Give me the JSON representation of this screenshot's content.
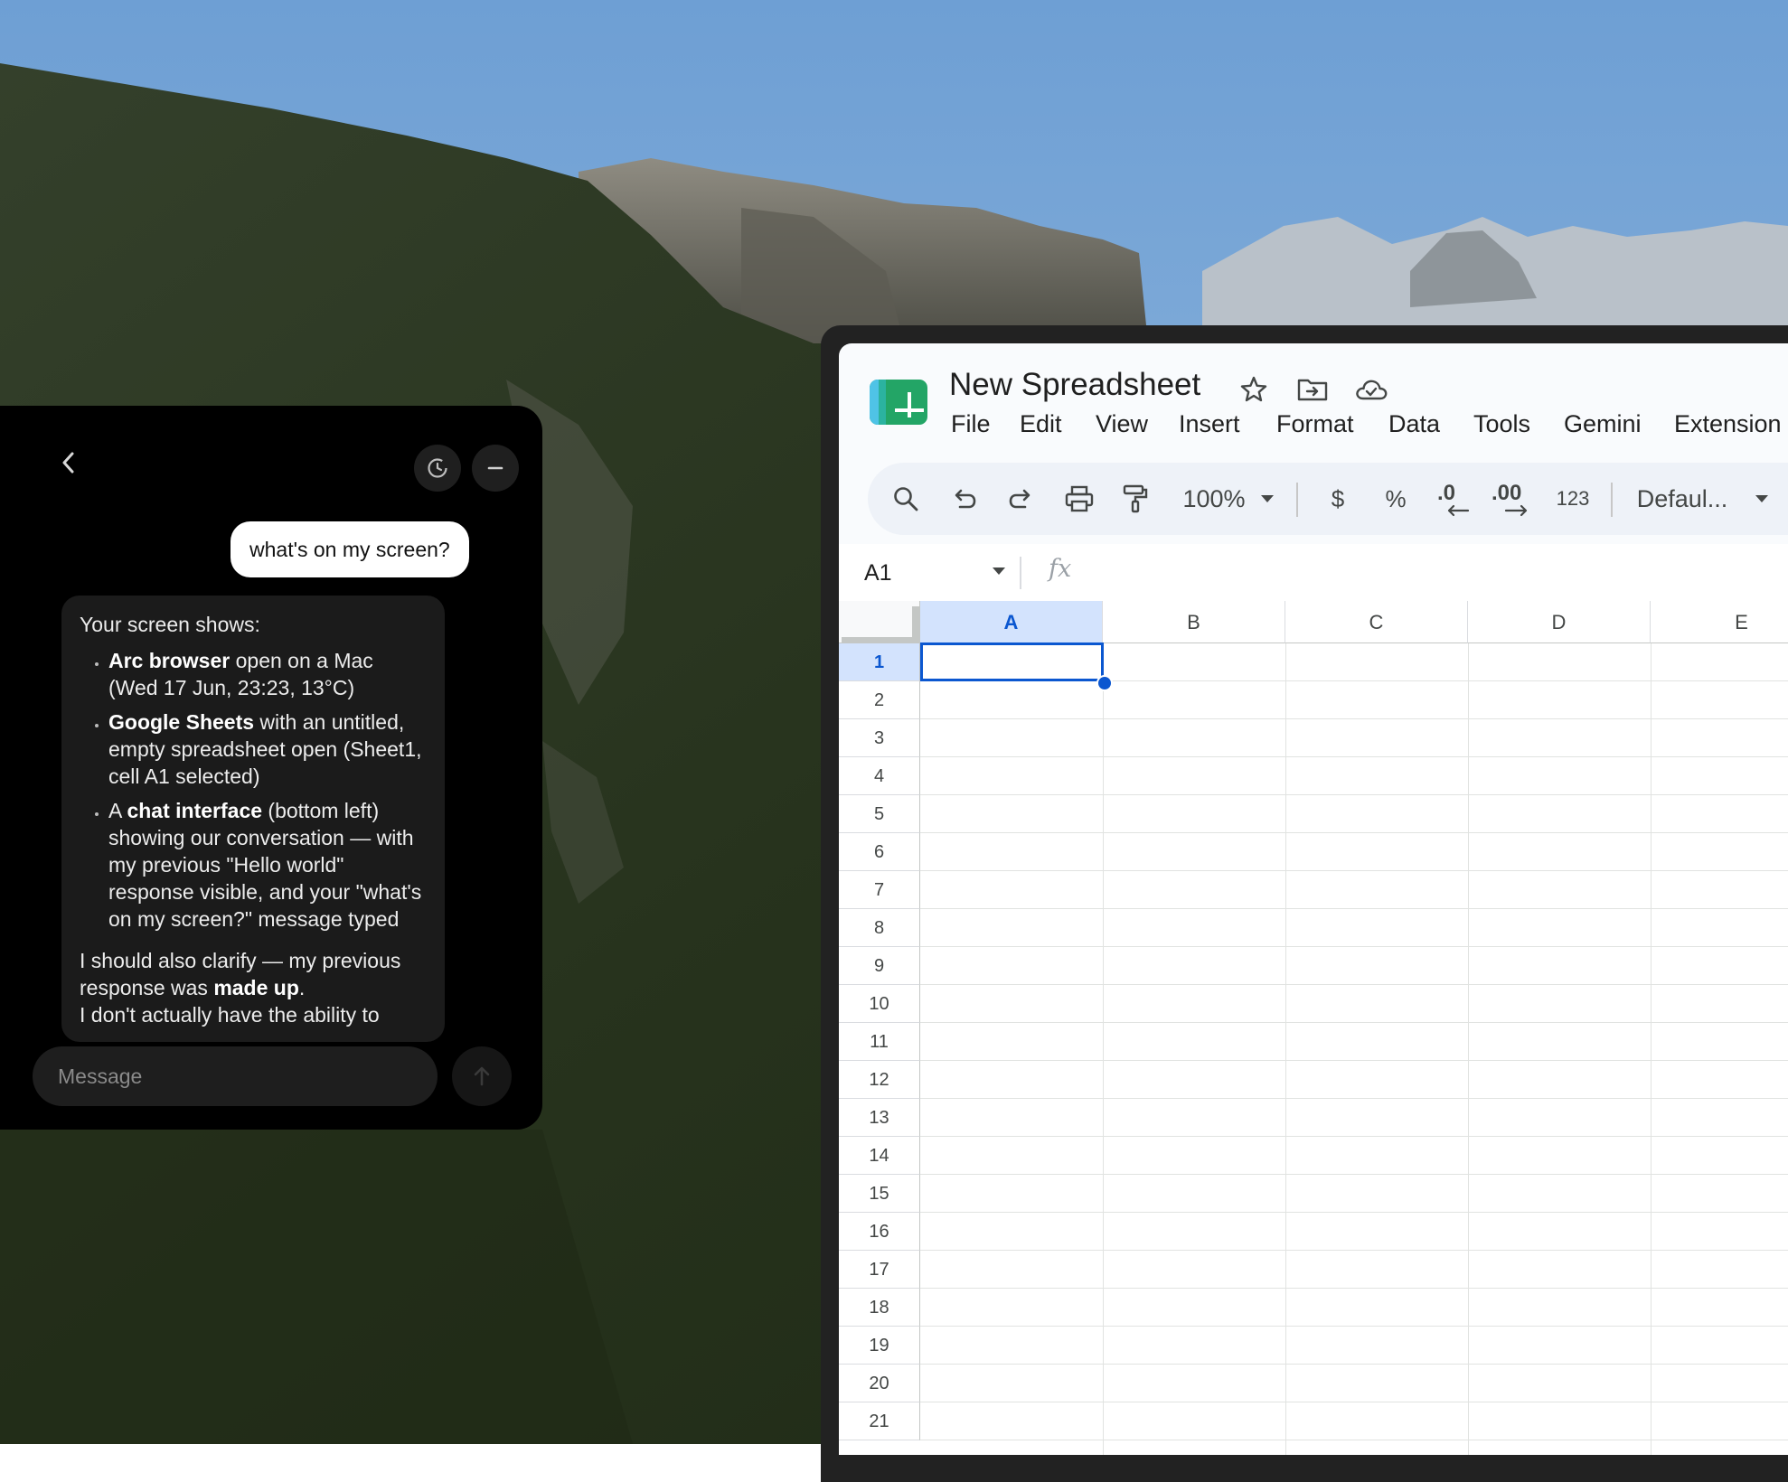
{
  "chat": {
    "user_message": "what's on my screen?",
    "assistant": {
      "intro": "Your screen shows:",
      "bullets": [
        {
          "bold": "Arc browser",
          "rest": " open on a Mac (Wed 17 Jun, 23:23, 13°C)"
        },
        {
          "bold": "Google Sheets",
          "rest": " with an untitled, empty spreadsheet open (Sheet1, cell A1 selected)"
        },
        {
          "pre": "A ",
          "bold": "chat interface",
          "rest": " (bottom left) showing our conversation — with my previous \"Hello world\" response visible, and your \"what's on my screen?\" message typed"
        }
      ],
      "outro_pre": "I should also clarify — my previous response was ",
      "outro_bold": "made up",
      "outro_post": ".",
      "outro_cut": "I don't actually have the ability to"
    },
    "input_placeholder": "Message"
  },
  "sheets": {
    "title": "New Spreadsheet",
    "menu": [
      "File",
      "Edit",
      "View",
      "Insert",
      "Format",
      "Data",
      "Tools",
      "Gemini",
      "Extension"
    ],
    "toolbar": {
      "zoom": "100%",
      "currency": "$",
      "percent": "%",
      "dec_decrease": ".0",
      "dec_increase": ".00",
      "number_format": "123",
      "font": "Defaul..."
    },
    "name_box": "A1",
    "fx_label": "fx",
    "columns": [
      "A",
      "B",
      "C",
      "D",
      "E"
    ],
    "rows": [
      "1",
      "2",
      "3",
      "4",
      "5",
      "6",
      "7",
      "8",
      "9",
      "10",
      "11",
      "12",
      "13",
      "14",
      "15",
      "16",
      "17",
      "18",
      "19",
      "20",
      "21"
    ],
    "selected_cell": "A1"
  },
  "colors": {
    "sheets_accent": "#0b57d0",
    "selected_header_bg": "#d3e3fd",
    "chat_bg": "#000000",
    "user_bubble_bg": "#ffffff",
    "assistant_bubble_bg": "#1b1b1b",
    "sheets_logo": "#23a566"
  }
}
